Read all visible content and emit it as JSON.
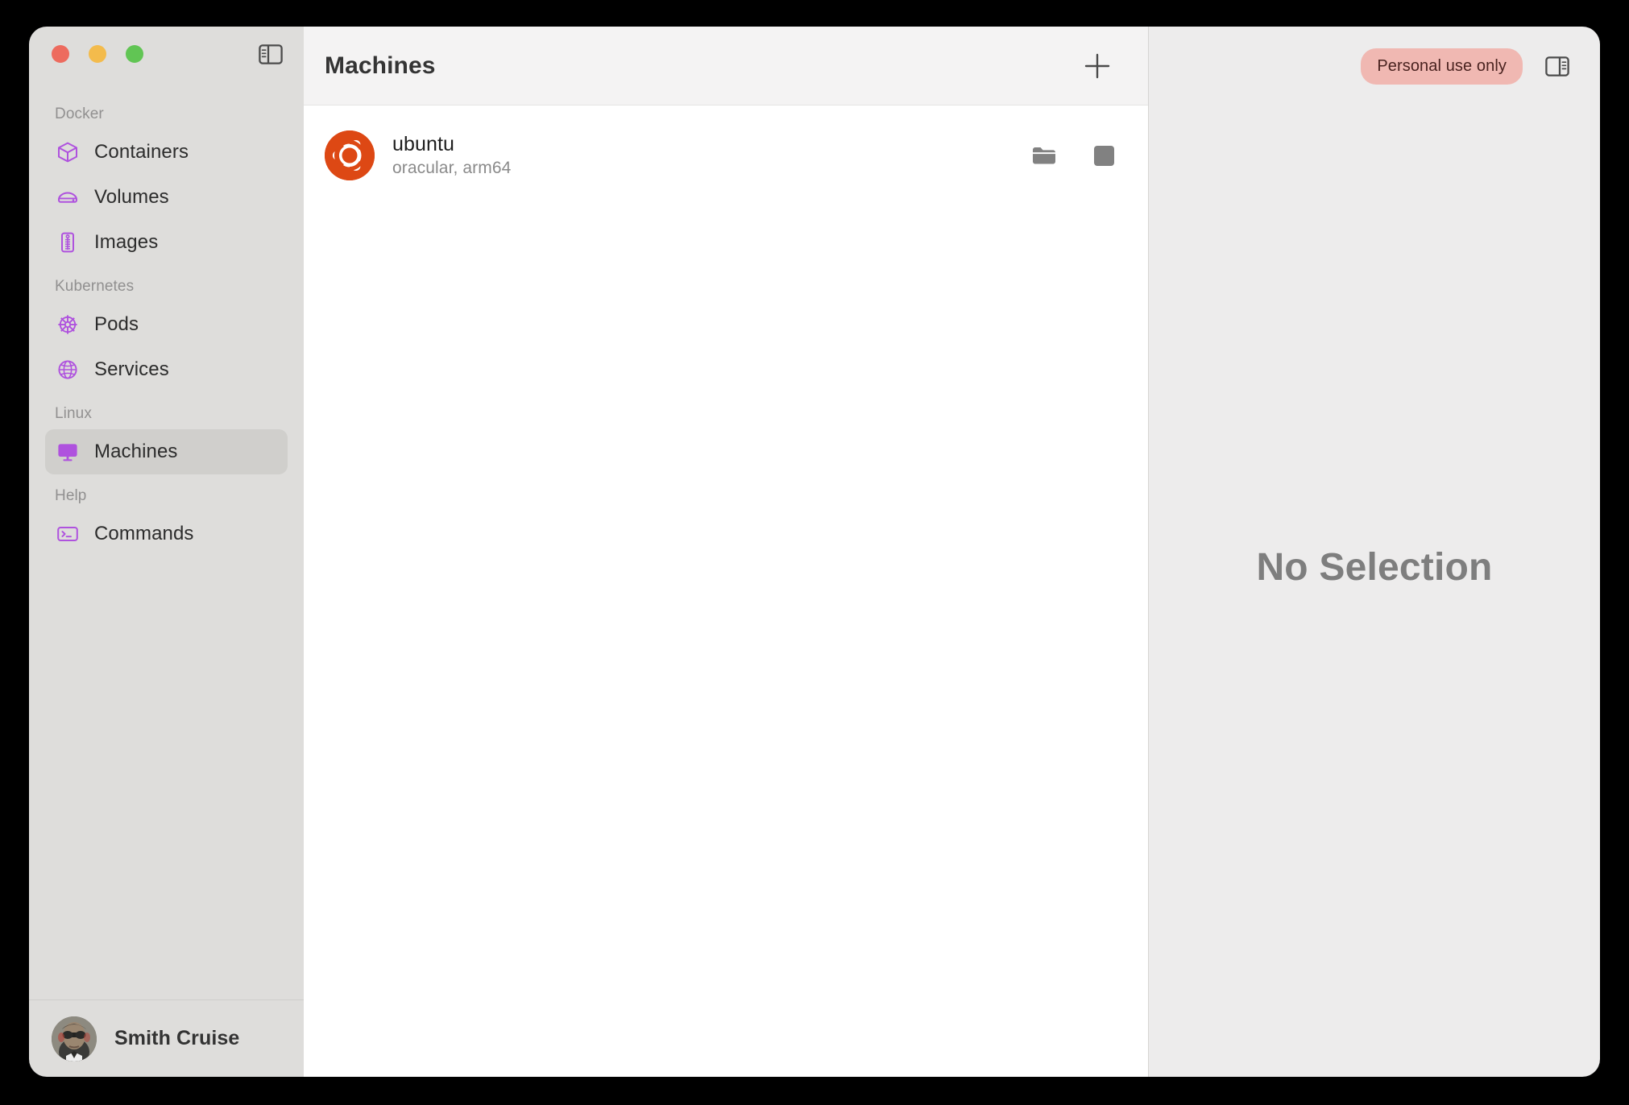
{
  "window": {
    "traffic_lights": [
      {
        "name": "close",
        "color": "#ED6B5E"
      },
      {
        "name": "minimize",
        "color": "#F3BB4C"
      },
      {
        "name": "maximize",
        "color": "#61C554"
      }
    ],
    "sidebar_toggle_icon": "sidebar-toggle-icon"
  },
  "sidebar": {
    "sections": [
      {
        "title": "Docker",
        "items": [
          {
            "label": "Containers",
            "icon": "cube-icon",
            "selected": false
          },
          {
            "label": "Volumes",
            "icon": "drive-icon",
            "selected": false
          },
          {
            "label": "Images",
            "icon": "archive-icon",
            "selected": false
          }
        ]
      },
      {
        "title": "Kubernetes",
        "items": [
          {
            "label": "Pods",
            "icon": "helm-wheel-icon",
            "selected": false
          },
          {
            "label": "Services",
            "icon": "globe-icon",
            "selected": false
          }
        ]
      },
      {
        "title": "Linux",
        "items": [
          {
            "label": "Machines",
            "icon": "display-icon",
            "selected": true
          }
        ]
      },
      {
        "title": "Help",
        "items": [
          {
            "label": "Commands",
            "icon": "terminal-icon",
            "selected": false
          }
        ]
      }
    ],
    "accent_color": "#AF52DE",
    "footer": {
      "user_name": "Smith Cruise",
      "avatar_icon": "user-avatar-photo"
    }
  },
  "list_pane": {
    "title": "Machines",
    "add_button_icon": "plus-icon",
    "machines": [
      {
        "name": "ubuntu",
        "subtitle": "oracular, arm64",
        "logo_icon": "ubuntu-logo-icon",
        "logo_color": "#DD4814",
        "actions": [
          {
            "name": "open-folder",
            "icon": "folder-icon"
          },
          {
            "name": "stop-machine",
            "icon": "stop-square-icon"
          }
        ]
      }
    ]
  },
  "detail_pane": {
    "badge": "Personal use only",
    "badge_color": "#F0B8B2",
    "inspector_toggle_icon": "inspector-toggle-icon",
    "empty_state": "No Selection"
  }
}
